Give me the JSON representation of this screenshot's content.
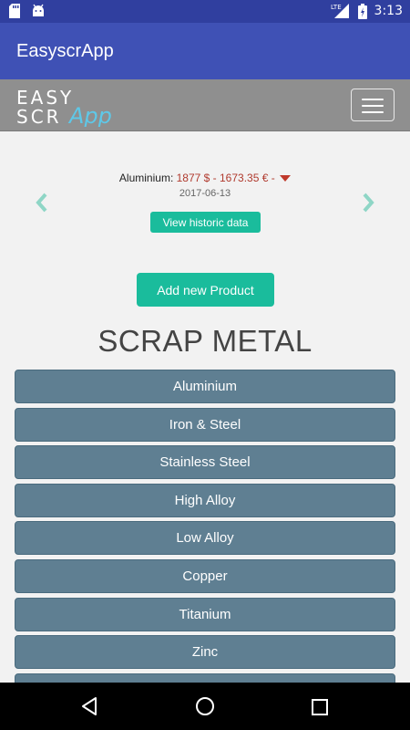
{
  "status_bar": {
    "time": "3:13",
    "network": "LTE"
  },
  "app_bar": {
    "title": "EasyscrApp"
  },
  "web_header": {
    "logo_line1": "EASY",
    "logo_line2a": "SCR",
    "logo_line2b": "App"
  },
  "price_ticker": {
    "metal": "Aluminium:",
    "values": "1877 $ - 1673.35 € -",
    "date": "2017-06-13",
    "historic_button": "View historic data",
    "trend": "down"
  },
  "add_product_button": "Add new Product",
  "section_title": "SCRAP METAL",
  "metals": [
    "Aluminium",
    "Iron & Steel",
    "Stainless Steel",
    "High Alloy",
    "Low Alloy",
    "Copper",
    "Titanium",
    "Zinc",
    ""
  ],
  "colors": {
    "accent": "#1abc9c",
    "app_bar": "#3f51b5",
    "status_bar": "#303f9f",
    "list_item": "#5f7f92",
    "price": "#b03a2e"
  },
  "icons": [
    "sd-card-icon",
    "android-icon",
    "signal-icon",
    "battery-icon",
    "hamburger-icon",
    "chevron-left-icon",
    "chevron-right-icon",
    "back-icon",
    "home-icon",
    "recent-apps-icon"
  ]
}
